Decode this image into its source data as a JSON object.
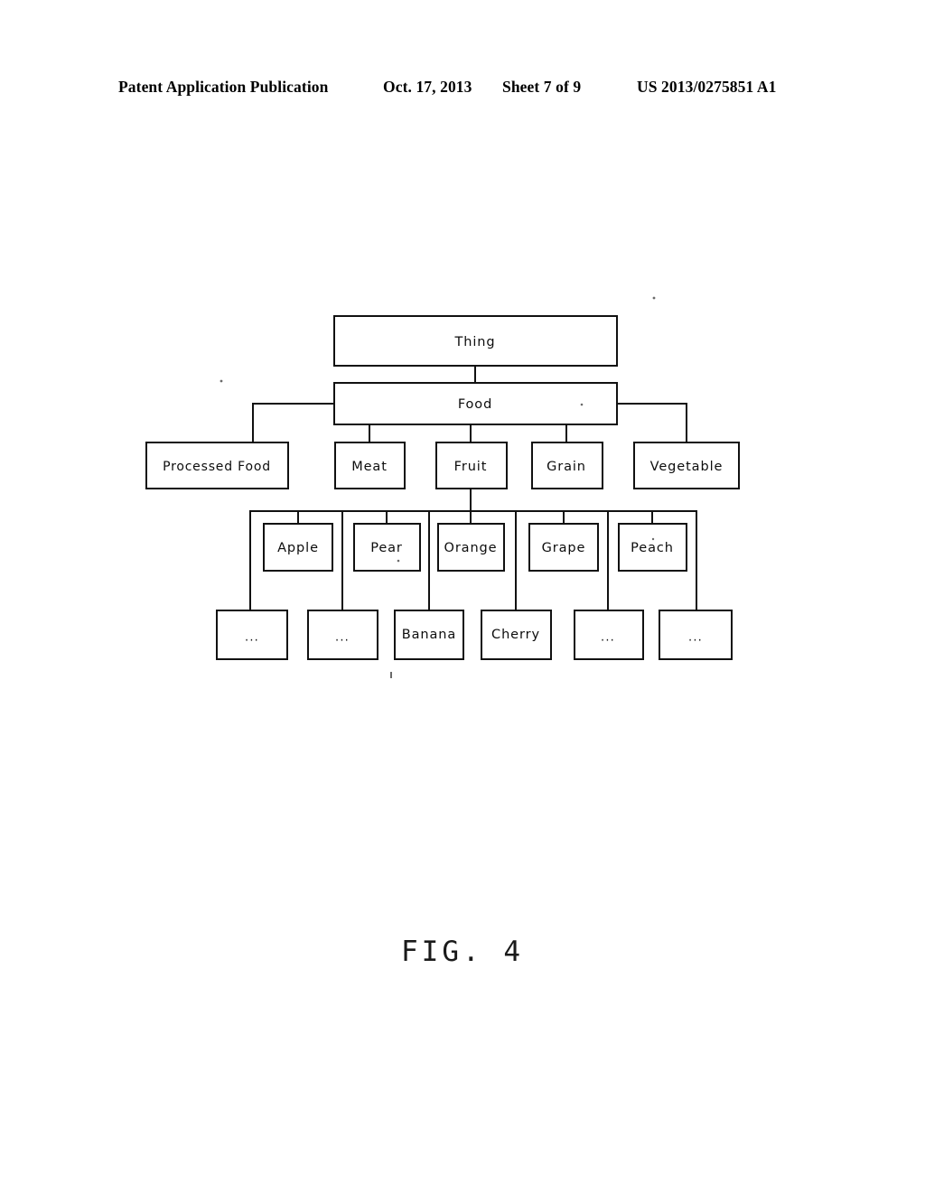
{
  "header": {
    "publication": "Patent Application Publication",
    "date": "Oct. 17, 2013",
    "sheet": "Sheet 7 of 9",
    "document_number": "US 2013/0275851 A1"
  },
  "figure": {
    "caption": "FIG. 4",
    "stroke_color": "#111111",
    "fill_color": "#ffffff",
    "text_color": "#0d0d0d"
  },
  "chart_data": {
    "type": "diagram",
    "title": "FIG. 4",
    "diagram_kind": "hierarchical tree / taxonomy",
    "root": "Thing",
    "levels": [
      {
        "level": 1,
        "nodes": [
          "Thing"
        ]
      },
      {
        "level": 2,
        "nodes": [
          "Food"
        ]
      },
      {
        "level": 3,
        "nodes": [
          "Processed Food",
          "Meat",
          "Fruit",
          "Grain",
          "Vegetable"
        ]
      },
      {
        "level": 4,
        "nodes": [
          "Apple",
          "Pear",
          "Orange",
          "Grape",
          "Peach"
        ]
      },
      {
        "level": 5,
        "nodes": [
          "...",
          "...",
          "Banana",
          "Cherry",
          "...",
          "..."
        ]
      }
    ],
    "edges": [
      {
        "from": "Thing",
        "to": "Food"
      },
      {
        "from": "Food",
        "to": "Processed Food"
      },
      {
        "from": "Food",
        "to": "Meat"
      },
      {
        "from": "Food",
        "to": "Fruit"
      },
      {
        "from": "Food",
        "to": "Grain"
      },
      {
        "from": "Food",
        "to": "Vegetable"
      },
      {
        "from": "Fruit",
        "to": "Apple"
      },
      {
        "from": "Fruit",
        "to": "Pear"
      },
      {
        "from": "Fruit",
        "to": "Orange"
      },
      {
        "from": "Fruit",
        "to": "Grape"
      },
      {
        "from": "Fruit",
        "to": "Peach"
      },
      {
        "from": "Fruit",
        "to": "..."
      },
      {
        "from": "Fruit",
        "to": "..."
      },
      {
        "from": "Fruit",
        "to": "Banana"
      },
      {
        "from": "Fruit",
        "to": "Cherry"
      },
      {
        "from": "Fruit",
        "to": "..."
      },
      {
        "from": "Fruit",
        "to": "..."
      }
    ]
  },
  "nodes": {
    "thing": "Thing",
    "food": "Food",
    "processed_food": "Processed Food",
    "meat": "Meat",
    "fruit": "Fruit",
    "grain": "Grain",
    "vegetable": "Vegetable",
    "apple": "Apple",
    "pear": "Pear",
    "orange": "Orange",
    "grape": "Grape",
    "peach": "Peach",
    "leaf_1": "...",
    "leaf_2": "...",
    "banana": "Banana",
    "cherry": "Cherry",
    "leaf_5": "...",
    "leaf_6": "..."
  }
}
